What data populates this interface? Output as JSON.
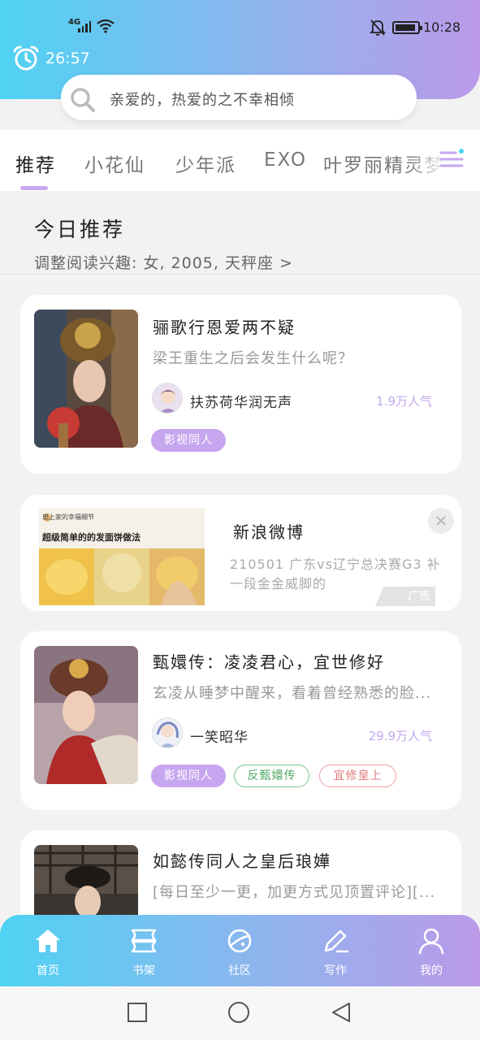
{
  "status_bar": {
    "signal_label": "4G",
    "time": "10:28"
  },
  "header": {
    "timer": "26:57"
  },
  "search": {
    "placeholder": "亲爱的，热爱的之不幸相倾"
  },
  "tabs": [
    {
      "label": "推荐",
      "active": true
    },
    {
      "label": "小花仙",
      "active": false
    },
    {
      "label": "少年派",
      "active": false
    },
    {
      "label": "EXO",
      "active": false
    },
    {
      "label": "叶罗丽精灵梦",
      "active": false
    }
  ],
  "recommend": {
    "title": "今日推荐",
    "subtitle": "调整阅读兴趣: 女, 2005, 天秤座 >"
  },
  "books": [
    {
      "title": "骊歌行恩爱两不疑",
      "desc": "梁王重生之后会发生什么呢？",
      "author": "扶苏荷华润无声",
      "popularity": "1.9万人气",
      "tags": [
        "影视同人"
      ]
    },
    {
      "title": "甄嬛传：凌凌君心，宜世修好",
      "desc": "玄凌从睡梦中醒来，看着曾经熟悉的脸...",
      "author": "一笑昭华",
      "popularity": "29.9万人气",
      "tags": [
        "影视同人",
        "反甄嬛传",
        "宜修皇上"
      ]
    },
    {
      "title": "如懿传同人之皇后琅嬅",
      "desc": "[每日至少一更，加更方式见顶置评论][..."
    }
  ],
  "ad": {
    "title": "新浪微博",
    "desc": "210501 广东vs辽宁总决赛G3 补一段金金威脚的",
    "badge": "广告",
    "image_header": "忠上家的幸福细节",
    "image_title": "超级简单的的发面饼做法"
  },
  "bottom_nav": [
    {
      "label": "首页",
      "icon": "home-icon"
    },
    {
      "label": "书架",
      "icon": "bookshelf-icon"
    },
    {
      "label": "社区",
      "icon": "planet-icon"
    },
    {
      "label": "写作",
      "icon": "pen-icon"
    },
    {
      "label": "我的",
      "icon": "user-icon"
    }
  ],
  "colors": {
    "gradient_start": "#4fd3f3",
    "gradient_end": "#bb9ae9",
    "accent": "#c6a6ee"
  }
}
